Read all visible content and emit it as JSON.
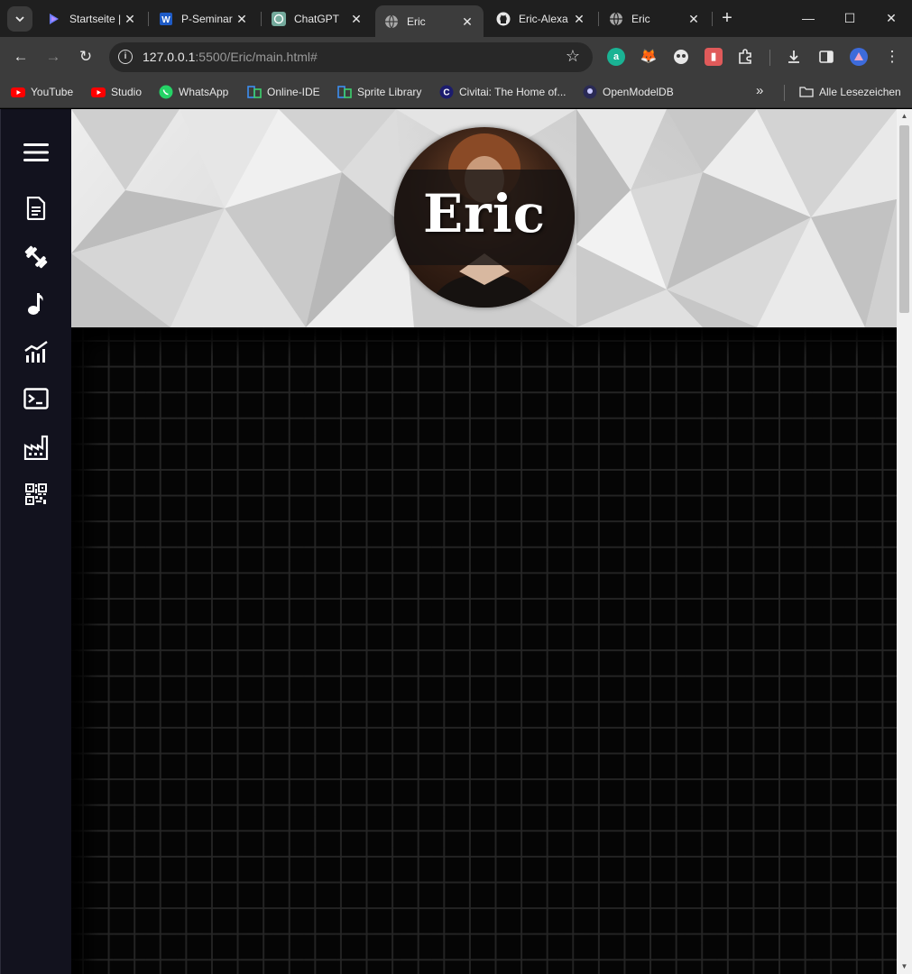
{
  "browser": {
    "tabs": [
      {
        "title": "Startseite | ",
        "favicon": "copilot-icon",
        "active": false
      },
      {
        "title": "P-Seminar",
        "favicon": "word-icon",
        "active": false
      },
      {
        "title": "ChatGPT",
        "favicon": "chatgpt-icon",
        "active": false
      },
      {
        "title": "Eric",
        "favicon": "globe-icon",
        "active": true
      },
      {
        "title": "Eric-Alexa",
        "favicon": "github-icon",
        "active": false
      },
      {
        "title": "Eric",
        "favicon": "globe-icon",
        "active": false
      }
    ],
    "address": {
      "host": "127.0.0.1",
      "rest": ":5500/Eric/main.html#"
    },
    "bookmarks": [
      {
        "label": "YouTube",
        "icon": "youtube-icon"
      },
      {
        "label": "Studio",
        "icon": "youtube-studio-icon"
      },
      {
        "label": "WhatsApp",
        "icon": "whatsapp-icon"
      },
      {
        "label": "Online-IDE",
        "icon": "ide-icon"
      },
      {
        "label": "Sprite Library",
        "icon": "ide-icon"
      },
      {
        "label": "Civitai: The Home of...",
        "icon": "civitai-icon"
      },
      {
        "label": "OpenModelDB",
        "icon": "openmodeldb-icon"
      }
    ],
    "all_bookmarks_label": "Alle Lesezeichen"
  },
  "site": {
    "hero_name": "Eric",
    "sidebar_icons": [
      "menu-icon",
      "document-icon",
      "dumbbell-icon",
      "music-note-icon",
      "chart-icon",
      "terminal-icon",
      "factory-icon",
      "qr-code-icon"
    ]
  },
  "colors": {
    "sidebar_bg": "#12121e",
    "page_bg": "#000000",
    "browser_frame": "#1f1f1f",
    "toolbar": "#3c3c3c"
  }
}
